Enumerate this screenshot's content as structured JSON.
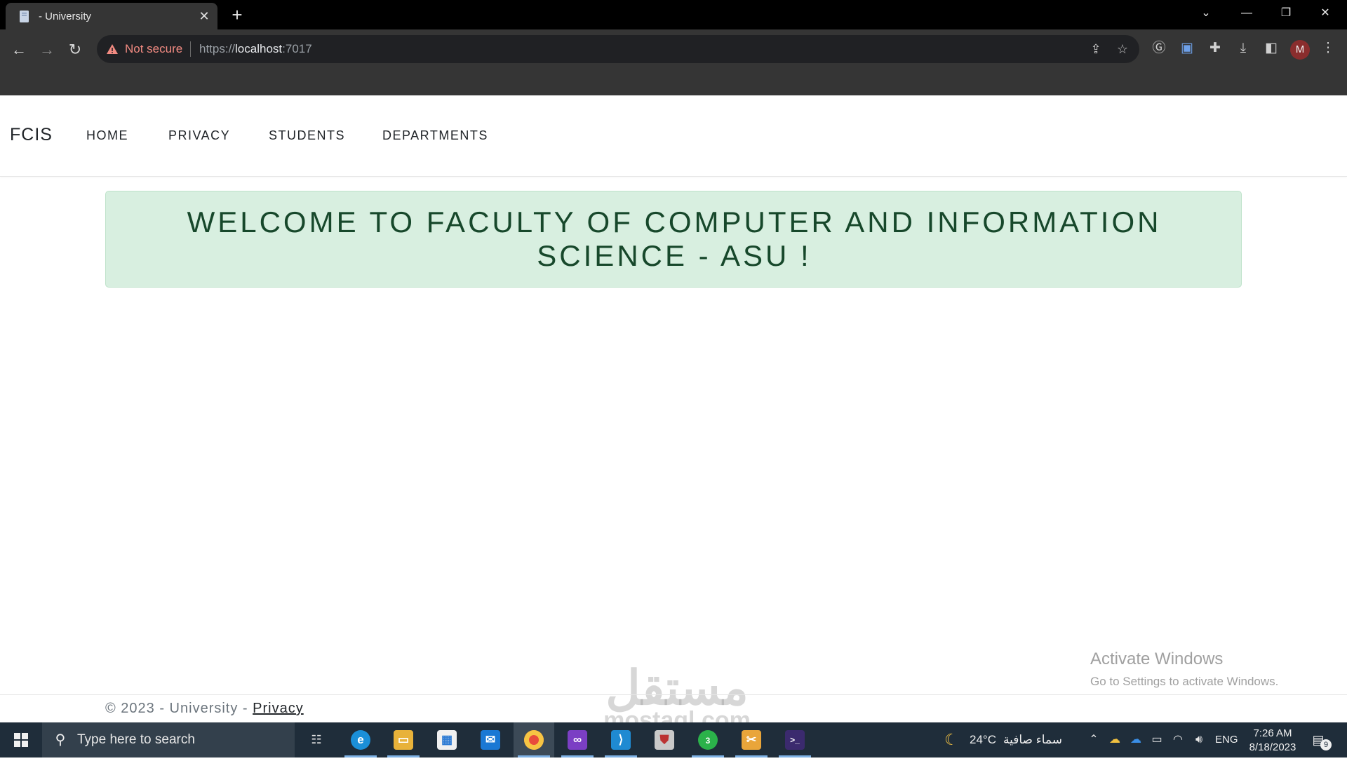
{
  "browser": {
    "tab_title": "- University",
    "not_secure_label": "Not secure",
    "url_scheme": "https://",
    "url_host": "localhost",
    "url_port": ":7017",
    "profile_initial": "M"
  },
  "site": {
    "brand": "FCIS",
    "nav": {
      "home": "HOME",
      "privacy": "PRIVACY",
      "students": "STUDENTS",
      "departments": "DEPARTMENTS"
    },
    "welcome_message": "WELCOME TO FACULTY OF COMPUTER AND INFORMATION SCIENCE - ASU !",
    "footer": {
      "copyright": "© 2023 - University - ",
      "privacy_link": "Privacy"
    }
  },
  "overlay": {
    "activate_title": "Activate Windows",
    "activate_sub": "Go to Settings to activate Windows.",
    "watermark_arabic": "مستقل",
    "watermark_latin": "mostaql.com"
  },
  "taskbar": {
    "search_placeholder": "Type here to search",
    "weather_temp": "24°C",
    "weather_text": "سماء صافية",
    "language": "ENG",
    "time": "7:26 AM",
    "date": "8/18/2023",
    "notification_count": "9",
    "whatsapp_badge": "3"
  },
  "colors": {
    "alert_bg": "#d8efe0",
    "alert_text": "#17482b",
    "taskbar_bg": "#1f2d3a",
    "not_secure": "#f28b82"
  }
}
